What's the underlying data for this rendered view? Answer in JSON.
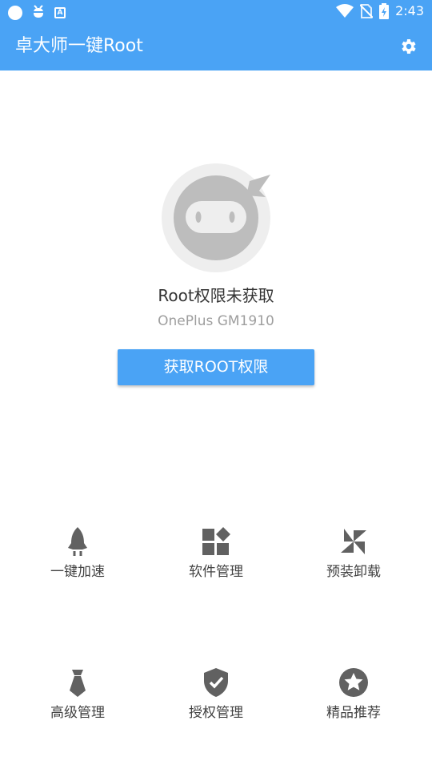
{
  "status_bar": {
    "time": "2:43",
    "left_icons": [
      "circle-icon",
      "bug-icon",
      "a-notification-icon"
    ],
    "right_icons": [
      "wifi-icon",
      "no-sim-icon",
      "battery-icon"
    ]
  },
  "app_bar": {
    "title": "卓大师一键Root",
    "settings_icon": "gear-icon",
    "color": "#4aa3f5"
  },
  "root_status": {
    "title": "Root权限未获取",
    "device": "OnePlus GM1910",
    "button_label": "获取ROOT权限",
    "avatar_icon": "ninja-icon"
  },
  "tools": [
    {
      "label": "一键加速",
      "icon": "rocket-icon"
    },
    {
      "label": "软件管理",
      "icon": "apps-icon"
    },
    {
      "label": "预装卸载",
      "icon": "pinwheel-icon"
    },
    {
      "label": "高级管理",
      "icon": "tie-icon"
    },
    {
      "label": "授权管理",
      "icon": "shield-check-icon"
    },
    {
      "label": "精品推荐",
      "icon": "star-badge-icon"
    }
  ],
  "colors": {
    "accent": "#4aa3f5",
    "icon_gray": "#616161"
  }
}
